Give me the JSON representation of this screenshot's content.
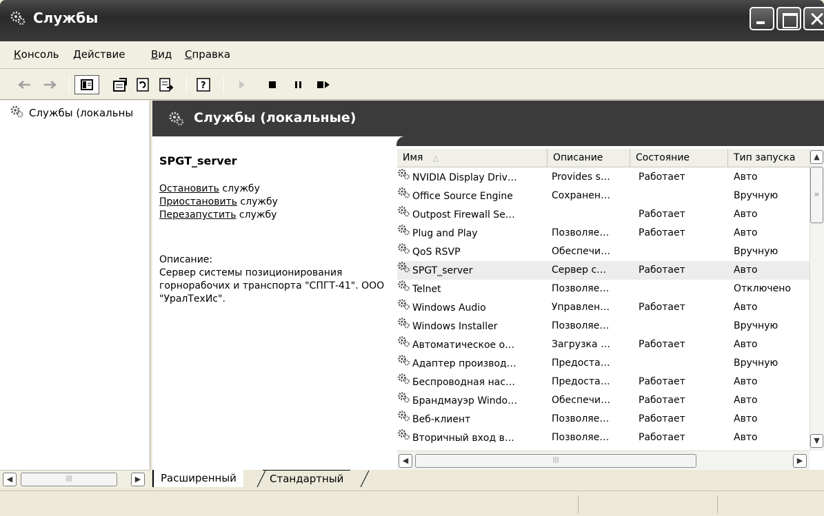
{
  "window": {
    "title": "Службы"
  },
  "menu": [
    {
      "label": "Консоль",
      "accel": "К",
      "rest": "онсоль"
    },
    {
      "label": "Действие",
      "accel": "Д",
      "rest": "ействие"
    },
    {
      "label": "Вид",
      "accel": "В",
      "rest": "ид"
    },
    {
      "label": "Справка",
      "accel": "С",
      "rest": "правка"
    }
  ],
  "toolbar": {
    "icons": [
      "back-icon",
      "forward-icon",
      "show-hide-tree-icon",
      "properties-icon",
      "refresh-icon",
      "export-list-icon",
      "help-icon",
      "start-service-icon",
      "stop-service-icon",
      "pause-service-icon",
      "restart-service-icon"
    ]
  },
  "tree": {
    "root_label": "Службы (локальны"
  },
  "panel": {
    "title": "Службы (локальные)"
  },
  "detail": {
    "service_name": "SPGT_server",
    "stop_link": "Остановить",
    "stop_suffix": " службу",
    "pause_link": "Приостановить",
    "pause_suffix": " службу",
    "restart_link": "Перезапустить",
    "restart_suffix": " службу",
    "description_label": "Описание:",
    "description_text": "Сервер системы позиционирования горнорабочих и транспорта \"СПГТ-41\". ООО \"УралТехИс\"."
  },
  "columns": [
    {
      "label": "Имя",
      "sort": "△"
    },
    {
      "label": "Описание"
    },
    {
      "label": "Состояние"
    },
    {
      "label": "Тип запуска"
    }
  ],
  "services": [
    {
      "name": "NVIDIA Display Driv…",
      "description": "Provides s…",
      "status": "Работает",
      "startup": "Авто"
    },
    {
      "name": "Office Source Engine",
      "description": "Сохранен…",
      "status": "",
      "startup": "Вручную"
    },
    {
      "name": "Outpost Firewall Se…",
      "description": "",
      "status": "Работает",
      "startup": "Авто"
    },
    {
      "name": "Plug and Play",
      "description": "Позволяе…",
      "status": "Работает",
      "startup": "Авто"
    },
    {
      "name": "QoS RSVP",
      "description": "Обеспечи…",
      "status": "",
      "startup": "Вручную"
    },
    {
      "name": "SPGT_server",
      "description": "Сервер с…",
      "status": "Работает",
      "startup": "Авто",
      "selected": true
    },
    {
      "name": "Telnet",
      "description": "Позволяе…",
      "status": "",
      "startup": "Отключено"
    },
    {
      "name": "Windows Audio",
      "description": "Управлен…",
      "status": "Работает",
      "startup": "Авто"
    },
    {
      "name": "Windows Installer",
      "description": "Позволяе…",
      "status": "",
      "startup": "Вручную"
    },
    {
      "name": "Автоматическое о…",
      "description": "Загрузка …",
      "status": "Работает",
      "startup": "Авто"
    },
    {
      "name": "Адаптер производ…",
      "description": "Предоста…",
      "status": "",
      "startup": "Вручную"
    },
    {
      "name": "Беспроводная нас…",
      "description": "Предоста…",
      "status": "Работает",
      "startup": "Авто"
    },
    {
      "name": "Брандмауэр Windo…",
      "description": "Обеспечи…",
      "status": "Работает",
      "startup": "Авто"
    },
    {
      "name": "Веб-клиент",
      "description": "Позволяе…",
      "status": "Работает",
      "startup": "Авто"
    },
    {
      "name": "Вторичный вход в…",
      "description": "Позволяе…",
      "status": "Работает",
      "startup": "Авто"
    }
  ],
  "tabs": [
    {
      "label": "Расширенный",
      "active": true
    },
    {
      "label": "Стандартный",
      "active": false
    }
  ]
}
